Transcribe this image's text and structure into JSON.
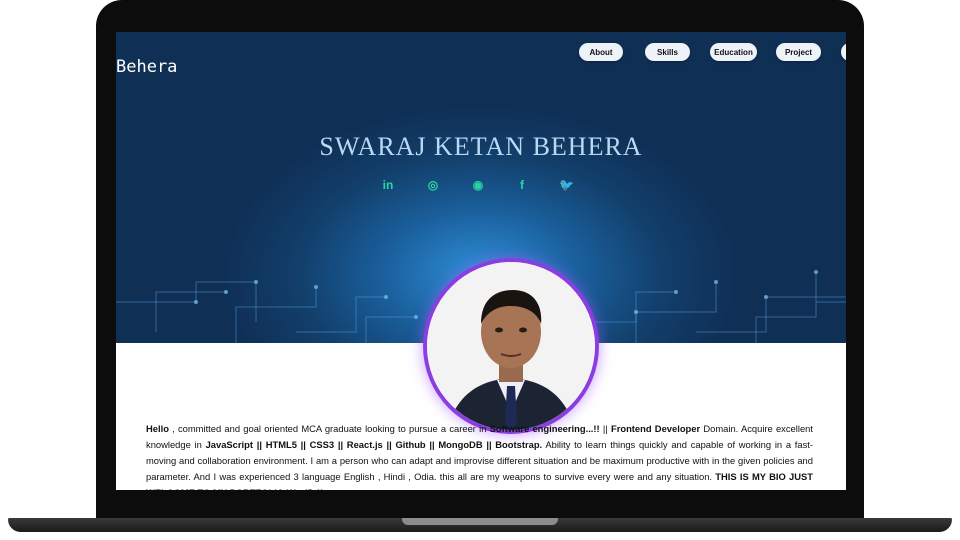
{
  "site": {
    "brand": "Behera",
    "nav": [
      "About",
      "Skills",
      "Education",
      "Project"
    ],
    "title": "SWARAJ KETAN BEHERA",
    "socials": [
      {
        "icon": "linkedin-icon",
        "glyph": "in"
      },
      {
        "icon": "whatsapp-icon",
        "glyph": "◎"
      },
      {
        "icon": "github-icon",
        "glyph": "◉"
      },
      {
        "icon": "facebook-icon",
        "glyph": "f"
      },
      {
        "icon": "twitter-icon",
        "glyph": "🐦"
      }
    ]
  },
  "bio": {
    "p1_a": "Hello",
    "p1_b": " , committed and goal oriented MCA graduate looking to pursue a career in ",
    "p1_c": "Software engineering...!!",
    "p1_d": " || ",
    "p1_e": "Frontend Developer",
    "p1_f": " Domain. Acquire excellent knowledge in ",
    "p1_g": "JavaScript || HTML5 || CSS3 || React.js || Github || MongoDB || Bootstrap.",
    "p1_h": " Ability to learn things quickly and capable of working in a fast-moving and collaboration environment. I am a person who can adapt and improvise different situation and be maximum productive with in the given policies and parameter. And I was experienced 3 language English , Hindi , Odia. this all are my weapons to survive every were and any situation. ",
    "p1_i": "THIS IS MY BIO JUST WELCOME TO MY PORTFOLIO WorlD !!"
  },
  "colors": {
    "accent": "#2ad6a0",
    "title": "#b9d9f3",
    "ring": "#8a3ee0"
  }
}
